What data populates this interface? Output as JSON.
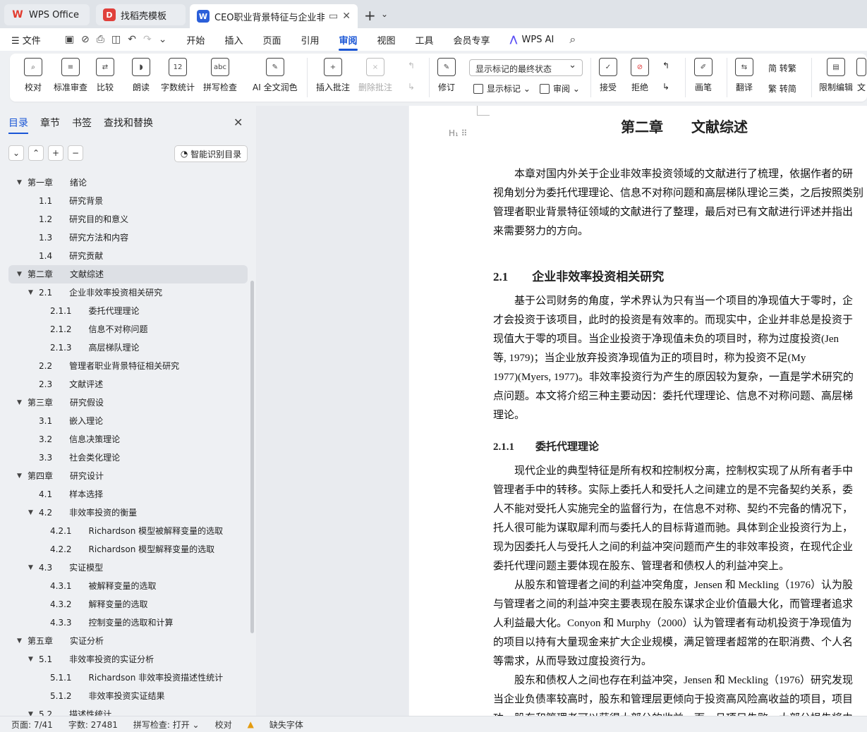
{
  "tabs": {
    "wps": "WPS Office",
    "template": "找稻壳模板",
    "doc": "CEO职业背景特征与企业非效率"
  },
  "menu": {
    "file": "文件",
    "items": [
      "开始",
      "插入",
      "页面",
      "引用",
      "审阅",
      "视图",
      "工具",
      "会员专享"
    ],
    "active": "审阅",
    "ai": "WPS AI"
  },
  "ribbon": {
    "proof": "校对",
    "std": "标准审查",
    "compare": "比较",
    "read": "朗读",
    "wordcount": "字数统计",
    "spell": "拼写检查",
    "ai_polish": "AI 全文润色",
    "insert_comment": "插入批注",
    "delete_comment": "删除批注",
    "revise": "修订",
    "markup_select": "显示标记的最终状态",
    "show_markup": "显示标记",
    "review": "审阅",
    "accept": "接受",
    "reject": "拒绝",
    "pen": "画笔",
    "translate": "翻译",
    "to_trad": "简 转繁",
    "to_simp": "繁 转简",
    "restrict": "限制编辑",
    "more": "文"
  },
  "sidebar": {
    "tabs": [
      "目录",
      "章节",
      "书签",
      "查找和替换"
    ],
    "smart": "智能识别目录",
    "toc": [
      {
        "t": "第一章　　绪论",
        "l": 0
      },
      {
        "t": "1.1　　研究背景",
        "l": 1
      },
      {
        "t": "1.2　　研究目的和意义",
        "l": 1
      },
      {
        "t": "1.3　　研究方法和内容",
        "l": 1
      },
      {
        "t": "1.4　　研究贡献",
        "l": 1
      },
      {
        "t": "第二章　　文献综述",
        "l": 0,
        "sel": true
      },
      {
        "t": "2.1　　企业非效率投资相关研究",
        "l": 1,
        "exp": true
      },
      {
        "t": "2.1.1　　委托代理理论",
        "l": 2
      },
      {
        "t": "2.1.2　　信息不对称问题",
        "l": 2
      },
      {
        "t": "2.1.3　　高层梯队理论",
        "l": 2
      },
      {
        "t": "2.2　　管理者职业背景特征相关研究",
        "l": 1
      },
      {
        "t": "2.3　　文献评述",
        "l": 1
      },
      {
        "t": "第三章　　研究假设",
        "l": 0
      },
      {
        "t": "3.1　　嵌入理论",
        "l": 1
      },
      {
        "t": "3.2　　信息决策理论",
        "l": 1
      },
      {
        "t": "3.3　　社会类化理论",
        "l": 1
      },
      {
        "t": "第四章　　研究设计",
        "l": 0
      },
      {
        "t": "4.1　　样本选择",
        "l": 1
      },
      {
        "t": "4.2　　非效率投资的衡量",
        "l": 1,
        "exp": true
      },
      {
        "t": "4.2.1　　Richardson 模型被解释变量的选取",
        "l": 2
      },
      {
        "t": "4.2.2　　Richardson 模型解释变量的选取",
        "l": 2
      },
      {
        "t": "4.3　　实证模型",
        "l": 1,
        "exp": true
      },
      {
        "t": "4.3.1　　被解释变量的选取",
        "l": 2
      },
      {
        "t": "4.3.2　　解释变量的选取",
        "l": 2
      },
      {
        "t": "4.3.3　　控制变量的选取和计算",
        "l": 2
      },
      {
        "t": "第五章　　实证分析",
        "l": 0
      },
      {
        "t": "5.1　　非效率投资的实证分析",
        "l": 1,
        "exp": true
      },
      {
        "t": "5.1.1　　Richardson 非效率投资描述性统计",
        "l": 2
      },
      {
        "t": "5.1.2　　非效率投资实证结果",
        "l": 2
      },
      {
        "t": "5.2　　描述性统计",
        "l": 1,
        "exp": true
      }
    ]
  },
  "doc": {
    "chapter_title": "第二章　　文献综述",
    "intro": [
      "　　本章对国内外关于企业非效率投资领域的文献进行了梳理，依据作者的研",
      "视角划分为委托代理理论、信息不对称问题和高层梯队理论三类，之后按照类别",
      "管理者职业背景特征领域的文献进行了整理，最后对已有文献进行评述并指出",
      "来需要努力的方向。"
    ],
    "h21": "2.1　　企业非效率投资相关研究",
    "p21": [
      "　　基于公司财务的角度，学术界认为只有当一个项目的净现值大于零时，企",
      "才会投资于该项目，此时的投资是有效率的。而现实中，企业并非总是投资于",
      "现值大于零的项目。当企业投资于净现值未负的项目时，称为过度投资(Jen",
      "等, 1979)；当企业放弃投资净现值为正的项目时，称为投资不足(My",
      "1977)(Myers, 1977)。非效率投资行为产生的原因较为复杂，一直是学术研究的",
      "点问题。本文将介绍三种主要动因：委托代理理论、信息不对称问题、高层梯",
      "理论。"
    ],
    "h211": "2.1.1　　委托代理理论",
    "p211": [
      "　　现代企业的典型特征是所有权和控制权分离，控制权实现了从所有者手中",
      "管理者手中的转移。实际上委托人和受托人之间建立的是不完备契约关系，委",
      "人不能对受托人实施完全的监督行为，在信息不对称、契约不完备的情况下，",
      "托人很可能为谋取犀利而与委托人的目标背道而驰。具体到企业投资行为上，",
      "现为因委托人与受托人之间的利益冲突问题而产生的非效率投资，在现代企业",
      "委托代理问题主要体现在股东、管理者和债权人的利益冲突上。",
      "　　从股东和管理者之间的利益冲突角度，Jensen 和 Meckling（1976）认为股",
      "与管理者之间的利益冲突主要表现在股东谋求企业价值最大化，而管理者追求",
      "人利益最大化。Conyon 和 Murphy（2000）认为管理者有动机投资于净现值为",
      "的项目以持有大量现金来扩大企业规模，满足管理者超常的在职消费、个人名",
      "等需求，从而导致过度投资行为。",
      "　　股东和债权人之间也存在利益冲突，Jensen 和 Meckling（1976）研究发现",
      "当企业负债率较高时，股东和管理层更倾向于投资高风险高收益的项目，项目",
      "功，股东和管理者可以获得大部分的收益，而一旦项目失败，大部分损失将由"
    ]
  },
  "status": {
    "page": "页面: 7/41",
    "words": "字数: 27481",
    "spell": "拼写检查: 打开 ⌄",
    "proof": "校对",
    "font": "缺失字体"
  }
}
